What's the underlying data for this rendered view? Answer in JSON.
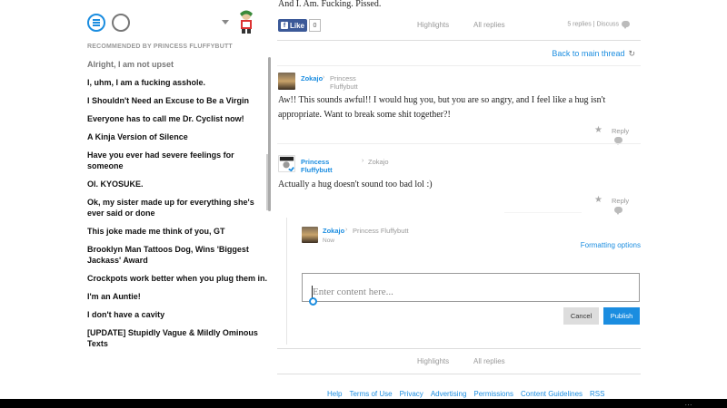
{
  "sidebar": {
    "heading": "RECOMMENDED BY PRINCESS FLUFFYBUTT",
    "items": [
      {
        "label": "Alright, I am not upset",
        "dim": true
      },
      {
        "label": "I, uhm, I am a fucking asshole."
      },
      {
        "label": "I Shouldn't Need an Excuse to Be a Virgin"
      },
      {
        "label": "Everyone has to call me Dr. Cyclist now!"
      },
      {
        "label": "A Kinja Version of Silence"
      },
      {
        "label": "Have you ever had severe feelings for someone"
      },
      {
        "label": "Ol. KYOSUKE."
      },
      {
        "label": "Ok, my sister made up for everything she's ever said or done"
      },
      {
        "label": "This joke made me think of you, GT"
      },
      {
        "label": "Brooklyn Man Tattoos Dog, Wins 'Biggest Jackass' Award"
      },
      {
        "label": "Crockpots work better when you plug them in."
      },
      {
        "label": "I'm an Auntie!"
      },
      {
        "label": "I don't have a cavity"
      },
      {
        "label": "[UPDATE] Stupidly Vague & Mildly Ominous Texts"
      }
    ]
  },
  "thread": {
    "previous_text": "And I. Am. Fucking. Pissed.",
    "like_label": "Like",
    "like_count": "0",
    "highlights_label": "Highlights",
    "all_replies_label": "All replies",
    "replies_discuss": "5 replies | Discuss",
    "back_label": "Back to main thread"
  },
  "comments": [
    {
      "author": "Zokajo",
      "reply_to": "Princess Fluffybutt",
      "body": "Aw!! This sounds awful!! I would hug you, but you are so angry, and I feel like a hug isn't appropriate. Want to break some shit together?!",
      "reply_label": "Reply"
    },
    {
      "author": "Princess Fluffybutt",
      "reply_to": "Zokajo",
      "body": "Actually a hug doesn't sound too bad lol :)",
      "reply_label": "Reply"
    }
  ],
  "composer": {
    "author": "Zokajo",
    "reply_to": "Princess Fluffybutt",
    "time": "Now",
    "formatting_label": "Formatting options",
    "placeholder": "Enter content here...",
    "cancel_label": "Cancel",
    "publish_label": "Publish"
  },
  "bottom_tabs": {
    "highlights_label": "Highlights",
    "all_replies_label": "All replies"
  },
  "footer": {
    "links": [
      "Help",
      "Terms of Use",
      "Privacy",
      "Advertising",
      "Permissions",
      "Content Guidelines",
      "RSS"
    ]
  },
  "taskbar": {
    "dots": "..."
  },
  "colors": {
    "accent": "#1b8de0",
    "facebook": "#3b5998"
  }
}
